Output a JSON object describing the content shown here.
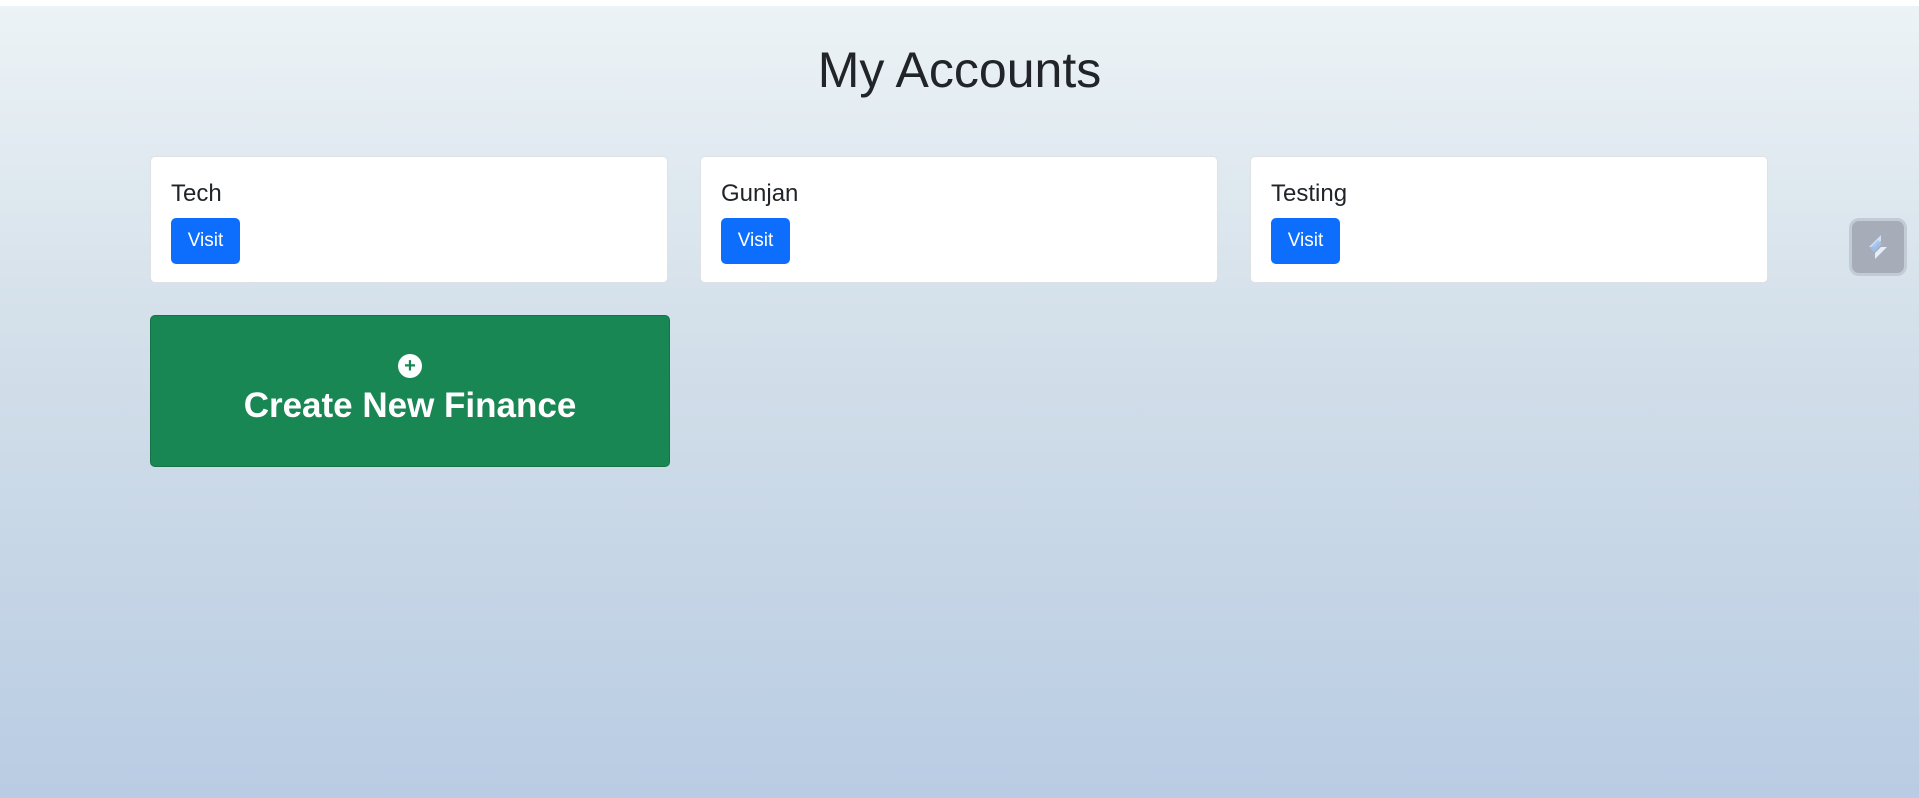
{
  "page": {
    "title": "My Accounts"
  },
  "accounts": [
    {
      "name": "Tech",
      "button_label": "Visit"
    },
    {
      "name": "Gunjan",
      "button_label": "Visit"
    },
    {
      "name": "Testing",
      "button_label": "Visit"
    }
  ],
  "create_card": {
    "label": "Create New Finance",
    "icon": "plus-circle-icon"
  },
  "floating_widget": {
    "icon": "extension-logo-icon"
  },
  "colors": {
    "primary_button": "#0d6efd",
    "create_card_background": "#198754",
    "gradient_top": "#ecf3f6",
    "gradient_bottom": "#b9cce3"
  }
}
